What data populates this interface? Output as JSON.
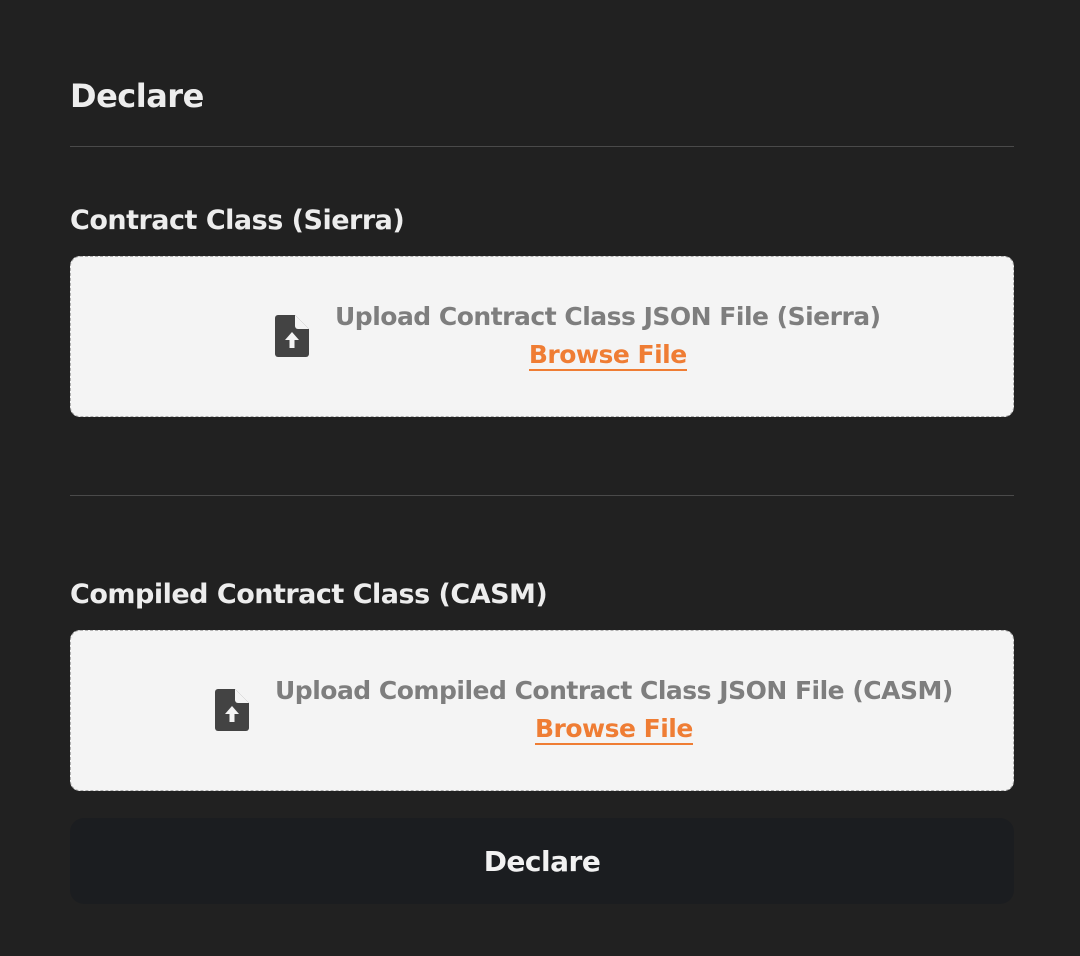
{
  "page": {
    "title": "Declare"
  },
  "sierra": {
    "label": "Contract Class (Sierra)",
    "upload_text": "Upload Contract Class JSON File (Sierra)",
    "browse_label": "Browse File",
    "icon": "file-upload-icon"
  },
  "casm": {
    "label": "Compiled Contract Class (CASM)",
    "upload_text": "Upload Compiled Contract Class JSON File (CASM)",
    "browse_label": "Browse File",
    "icon": "file-upload-icon"
  },
  "actions": {
    "declare_label": "Declare"
  },
  "colors": {
    "background": "#212121",
    "dropzone": "#f4f4f4",
    "accent": "#ef7d34",
    "button": "#1b1d20"
  }
}
